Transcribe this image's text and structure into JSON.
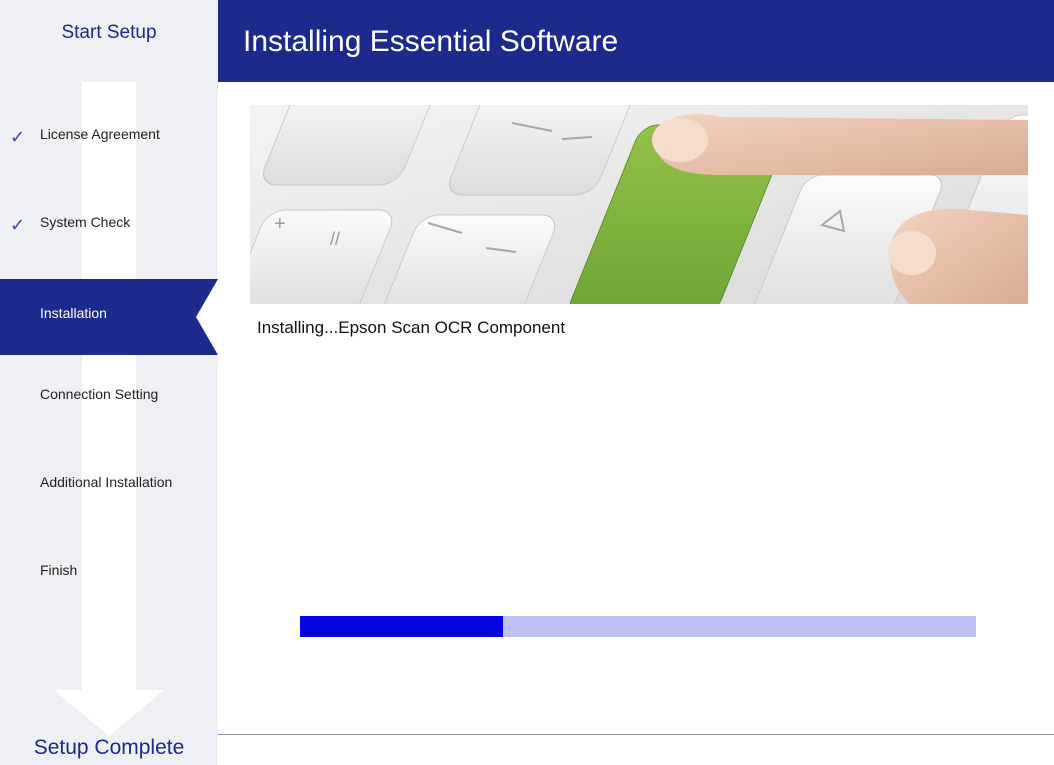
{
  "sidebar": {
    "start_label": "Start Setup",
    "complete_label": "Setup Complete",
    "steps": [
      {
        "label": "License Agreement",
        "check": "✓"
      },
      {
        "label": "System Check",
        "check": "✓"
      },
      {
        "label": "Installation"
      },
      {
        "label": "Connection Setting"
      },
      {
        "label": "Additional Installation"
      },
      {
        "label": "Finish"
      }
    ]
  },
  "header": {
    "title": "Installing Essential Software"
  },
  "main": {
    "status_text": "Installing...Epson Scan OCR Component",
    "progress_fraction": 0.3
  },
  "colors": {
    "brand_navy": "#1c2a8c",
    "progress_fill": "#0407e0",
    "progress_track": "#bfc1f2",
    "key_green": "#7fb43d"
  }
}
